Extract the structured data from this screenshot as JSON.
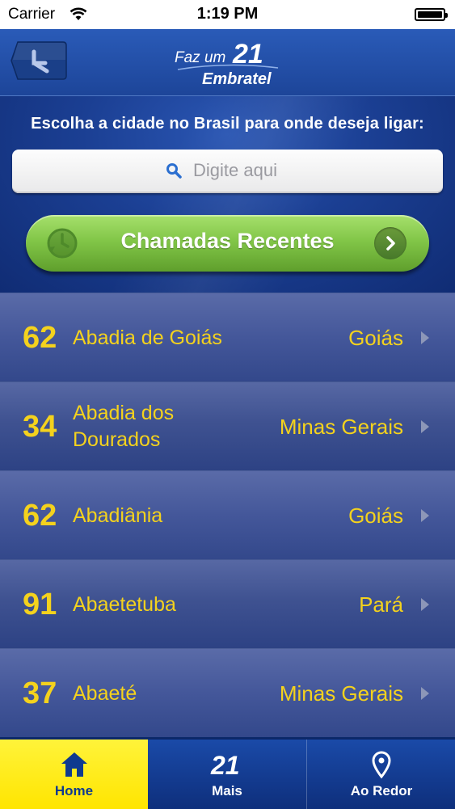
{
  "status_bar": {
    "carrier": "Carrier",
    "time": "1:19 PM"
  },
  "header": {
    "logo_line1": "Faz um",
    "logo_number": "21",
    "logo_line2": "Embratel",
    "prompt": "Escolha a cidade no Brasil para onde deseja ligar:"
  },
  "search": {
    "placeholder": "Digite aqui"
  },
  "recent_calls": {
    "label": "Chamadas Recentes"
  },
  "cities": [
    {
      "code": "62",
      "name": "Abadia de Goiás",
      "state": "Goiás"
    },
    {
      "code": "34",
      "name": "Abadia dos Dourados",
      "state": "Minas Gerais"
    },
    {
      "code": "62",
      "name": "Abadiânia",
      "state": "Goiás"
    },
    {
      "code": "91",
      "name": "Abaetetuba",
      "state": "Pará"
    },
    {
      "code": "37",
      "name": "Abaeté",
      "state": "Minas Gerais"
    }
  ],
  "tabbar": {
    "items": [
      {
        "label": "Home",
        "icon": "home-icon",
        "selected": true
      },
      {
        "label": "Mais",
        "icon": "21-logo-icon",
        "selected": false
      },
      {
        "label": "Ao Redor",
        "icon": "location-pin-icon",
        "selected": false
      }
    ]
  },
  "colors": {
    "accent_yellow": "#f4d21d",
    "green_button": "#82c648",
    "tab_selected": "#ffe500",
    "navy": "#102c74"
  }
}
